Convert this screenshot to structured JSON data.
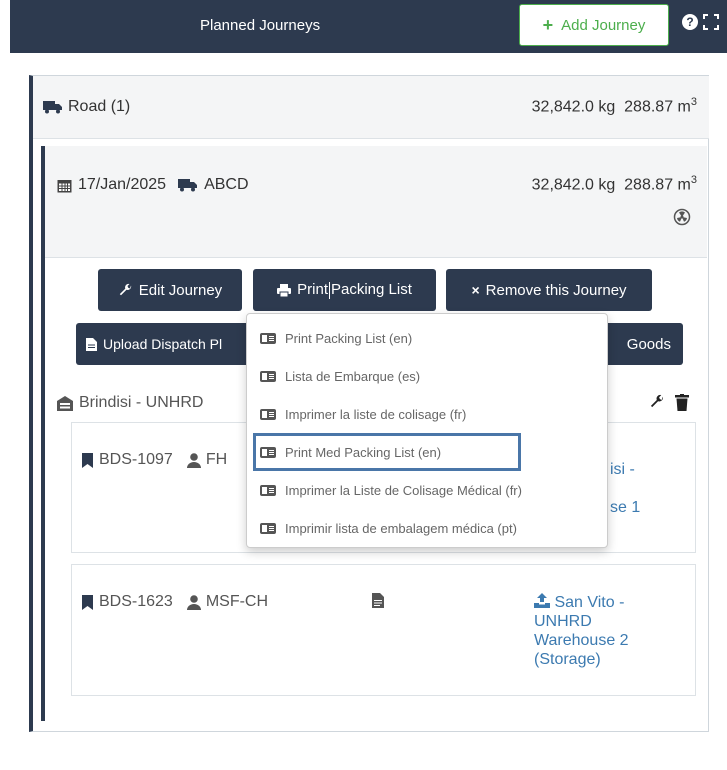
{
  "header": {
    "title": "Planned Journeys",
    "add_journey_label": "Add Journey",
    "help_glyph": "?"
  },
  "road": {
    "label": "Road (1)",
    "weight": "32,842.0 kg",
    "volume": "288.87 m",
    "volume_unit_sup": "3"
  },
  "journey": {
    "date": "17/Jan/2025",
    "vehicle": "ABCD",
    "weight": "32,842.0 kg",
    "volume": "288.87 m",
    "volume_unit_sup": "3",
    "buttons": {
      "edit": "Edit Journey",
      "print_part1": "Print",
      "print_part2": "Packing List",
      "remove": "Remove this Journey",
      "upload": "Upload Dispatch Pl",
      "goods": "Goods"
    },
    "location": "Brindisi - UNHRD",
    "cards": [
      {
        "ref": "BDS-1097",
        "party": "FH",
        "dest_line1": "isi -",
        "dest_line2": "se 1"
      },
      {
        "ref": "BDS-1623",
        "party": "MSF-CH",
        "dest_line1": "San Vito -",
        "dest_line2": "UNHRD",
        "dest_line3": "Warehouse 2",
        "dest_line4": "(Storage)"
      }
    ]
  },
  "print_menu": {
    "items": [
      "Print Packing List (en)",
      "Lista de Embarque (es)",
      "Imprimer la liste de colisage (fr)",
      "Print Med Packing List (en)",
      "Imprimer la Liste de Colisage Médical (fr)",
      "Imprimir lista de embalagem médica (pt)"
    ]
  },
  "colors": {
    "navy": "#2d3a4f",
    "green": "#4cae4c",
    "link_blue": "#3c7ab0",
    "highlight": "#4a76a8"
  }
}
